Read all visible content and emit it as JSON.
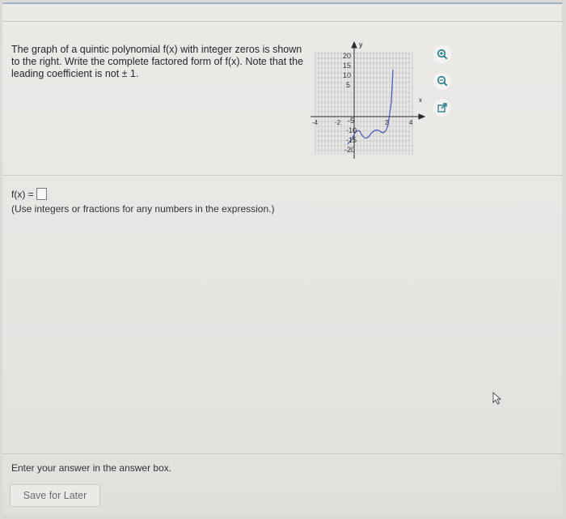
{
  "question": {
    "text": "The graph of a quintic polynomial f(x) with integer zeros is shown to the right. Write the complete factored form of f(x). Note that the leading coefficient is not ± 1."
  },
  "graph": {
    "y_axis_label": "y",
    "x_axis_label": "x",
    "y_tick_labels_positive": [
      "20",
      "15",
      "10",
      "5"
    ],
    "y_tick_labels_negative": [
      "-5",
      "-10",
      "-15",
      "-20"
    ],
    "x_tick_labels": [
      "-4",
      "-2",
      "2",
      "4"
    ],
    "curve_color": "#4a5fc4"
  },
  "tools": {
    "zoom_in": "zoom-in-icon",
    "zoom_out": "zoom-out-icon",
    "pop_out": "pop-out-icon"
  },
  "answer": {
    "label": "f(x) =",
    "hint": "(Use integers or fractions for any numbers in the expression.)"
  },
  "footer": {
    "instruction": "Enter your answer in the answer box.",
    "save_label": "Save for Later"
  },
  "colors": {
    "accent_teal": "#1f7e8a",
    "top_border": "#9fb3c8"
  }
}
